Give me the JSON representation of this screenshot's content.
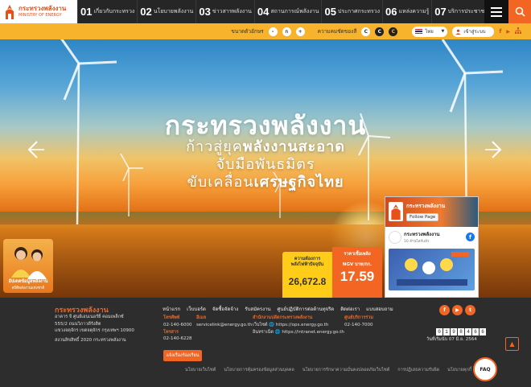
{
  "header": {
    "logo_th": "กระทรวงพลังงาน",
    "logo_en": "MINISTRY OF ENERGY",
    "nav": [
      {
        "num": "01",
        "label": "เกี่ยวกับกระทรวง"
      },
      {
        "num": "02",
        "label": "นโยบายพลังงาน"
      },
      {
        "num": "03",
        "label": "ข่าวสารพลังงาน"
      },
      {
        "num": "04",
        "label": "สถานการณ์พลังงาน"
      },
      {
        "num": "05",
        "label": "ประกาศกระทรวง"
      },
      {
        "num": "06",
        "label": "แหล่งความรู้"
      },
      {
        "num": "07",
        "label": "บริการประชาชน"
      }
    ]
  },
  "utility": {
    "font_size_label": "ขนาดตัวอักษร",
    "font_sizes": [
      "-",
      "ก",
      "+"
    ],
    "contrast_label": "ความคมชัดของสี",
    "contrast": [
      "C",
      "C",
      "C"
    ],
    "language": "ไทย",
    "login": "เข้าสู่ระบบ",
    "social": [
      "f",
      "▶",
      "👥"
    ]
  },
  "hero": {
    "title": "กระทรวงพลังงาน",
    "line1_plain": "ก้าวสู่ยุค",
    "line1_bold": "พลังงานสะอาด",
    "line2": "จับมือพันธมิตร",
    "line3_plain": "ขับเคลื่อน",
    "line3_bold": "เศรษฐกิจไทย"
  },
  "person_card": {
    "line1": "อัปเดตข้อมูลพลังงาน",
    "line2": "สถิติพลังงานแห่งชาติ"
  },
  "stats": {
    "demand_label_1": "ความต้องการ",
    "demand_label_2": "พลังไฟฟ้าปัจจุบัน",
    "demand_value": "26,672.8",
    "ngv_label_1": "ราคาเชื้อเพลิง",
    "ngv_label_2": "NGV บาท/กก.",
    "ngv_value": "17.59"
  },
  "facebook": {
    "page_name": "กระทรวงพลังงาน",
    "follow": "Follow Page",
    "post_name": "กระทรวงพลังงาน",
    "likes": "10 ล้านไลก์แล้ว"
  },
  "footer": {
    "brand": "กระทรวงพลังงาน",
    "address_1": "อาคาร จี ศูนย์เอนเนอร์ยี่ คอมเพล็กซ์",
    "address_2": "555/2 ถนนวิภาวดีรังสิต",
    "address_3": "แขวงจตุจักร เขตจตุจักร กรุงเทพฯ 10900",
    "copyright": "สงวนลิขสิทธิ์ 2020 กระทรวงพลังงาน",
    "links": [
      "หน้าแรก",
      "เว็บบอร์ด",
      "จัดซื้อจัดจ้าง",
      "รับสมัครงาน",
      "ศูนย์ปฏิบัติการต่อต้านทุจริต",
      "ติดต่อเรา",
      "แบบสอบถาม"
    ],
    "phone_label": "โทรศัพท์",
    "phone": "02-140-6000",
    "fax_label": "โทรสาร",
    "fax": "02-140-6228",
    "email_label": "อีเมล",
    "email": "servicelink@energy.go.th",
    "office_label": "สำนักงานปลัดกระทรวงพลังงาน",
    "web_label": "เว็บไซต์",
    "web_url": "https://ops.energy.go.th",
    "intranet_label": "อินทราเน็ต",
    "intranet_url": "https://intranet.energy.go.th",
    "service_label": "ศูนย์บริการร่วม",
    "service_phone": "02-140-7000",
    "cta": "แจ้งเรื่องร้องเรียน",
    "counter": [
      "0",
      "1",
      "9",
      "8",
      "4",
      "6",
      "6"
    ],
    "date": "วันที่เริ่มนับ 07 มิ.ย. 2564",
    "bottom_links": [
      "นโยบายเว็บไซต์",
      "นโยบายการคุ้มครองข้อมูลส่วนบุคคล",
      "นโยบายการรักษาความมั่นคงปลอดภัยเว็บไซต์",
      "การปฏิเสธความรับผิด",
      "นโยบายคุกกี้"
    ],
    "faq": "FAQ"
  }
}
